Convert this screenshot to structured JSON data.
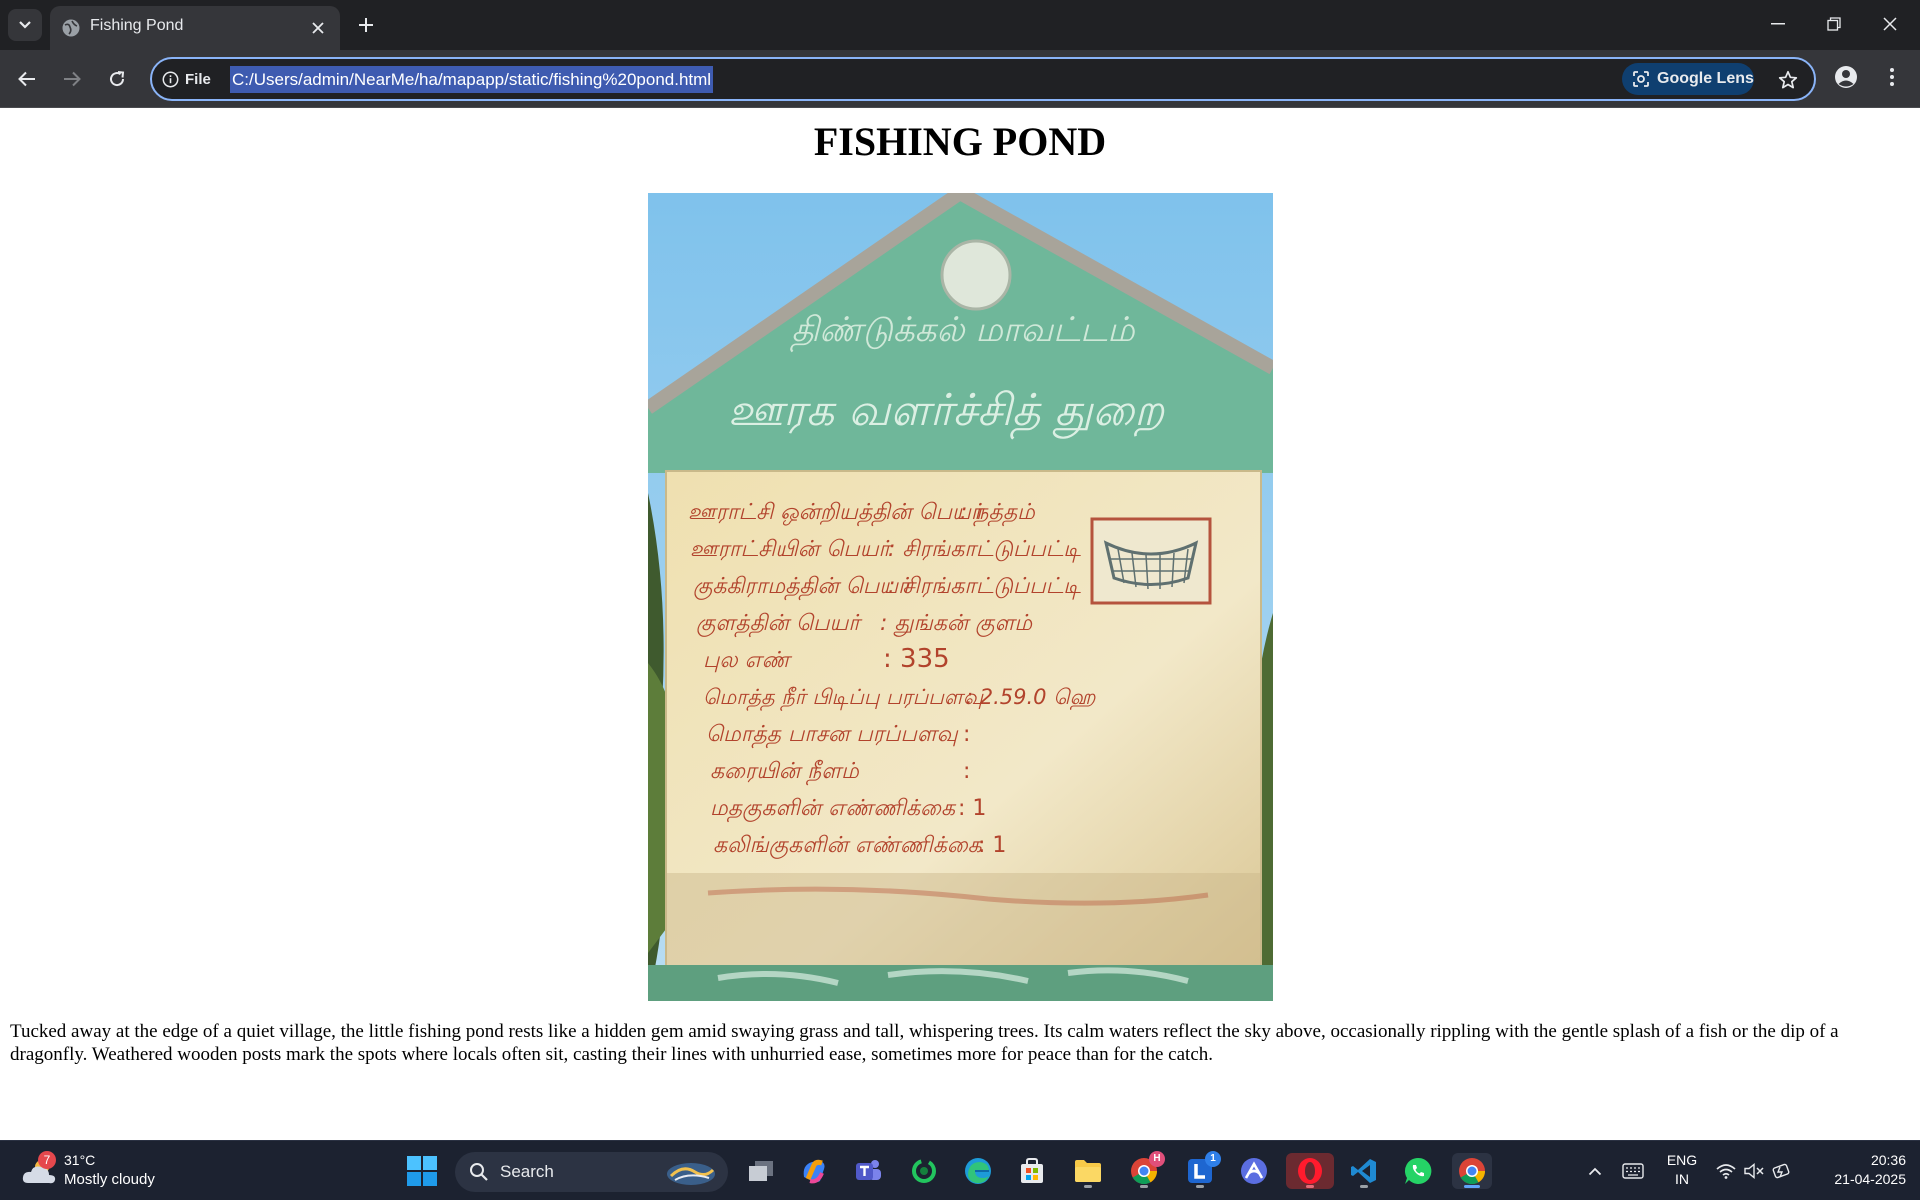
{
  "window": {
    "tab_title": "Fishing Pond"
  },
  "toolbar": {
    "site_chip_label": "File",
    "url": "C:/Users/admin/NearMe/ha/mapapp/static/fishing%20pond.html",
    "lens_label": "Google Lens"
  },
  "page": {
    "heading": "FISHING POND",
    "paragraph": "Tucked away at the edge of a quiet village, the little fishing pond rests like a hidden gem amid swaying grass and tall, whispering trees. Its calm waters reflect the sky above, occasionally rippling with the gentle splash of a fish or the dip of a dragonfly. Weathered wooden posts mark the spots where locals often sit, casting their lines with unhurried ease, sometimes more for peace than for the catch."
  },
  "photo": {
    "sign_upper_1": "திண்டுக்கல் மாவட்டம்",
    "sign_upper_2": "ஊரக வளர்ச்சித் துறை",
    "sign_rows": [
      {
        "label": "ஊராட்சி ஒன்றியத்தின் பெயர்",
        "value": ": நத்தம்"
      },
      {
        "label": "ஊராட்சியின் பெயர்",
        "value": ": சிரங்காட்டுப்பட்டி"
      },
      {
        "label": "குக்கிராமத்தின் பெயர்",
        "value": ": சிரங்காட்டுப்பட்டி"
      },
      {
        "label": "குளத்தின் பெயர்",
        "value": ": துங்கன் குளம்"
      },
      {
        "label": "புல எண்",
        "value": ": 335"
      },
      {
        "label": "மொத்த நீர் பிடிப்பு பரப்பளவு",
        "value": ": 2.59.0 ஹெ"
      },
      {
        "label": "மொத்த பாசன பரப்பளவு",
        "value": ":"
      },
      {
        "label": "கரையின் நீளம்",
        "value": ":"
      },
      {
        "label": "மதகுகளின் எண்ணிக்கை",
        "value": ": 1"
      },
      {
        "label": "கலிங்குகளின் எண்ணிக்கை",
        "value": ": 1"
      }
    ]
  },
  "taskbar": {
    "weather_badge": "7",
    "weather_temp": "31°C",
    "weather_desc": "Mostly cloudy",
    "search_label": "Search",
    "chrome_badge": "H",
    "l_app_badge": "1",
    "lang_line1": "ENG",
    "lang_line2": "IN",
    "clock_time": "20:36",
    "clock_date": "21-04-2025"
  },
  "colors": {
    "accent": "#8ab4f8",
    "url_selection": "#3e5bb0",
    "sign_green": "#6fb79a",
    "sign_cream": "#efe2b8",
    "sign_text": "#b2432c"
  }
}
